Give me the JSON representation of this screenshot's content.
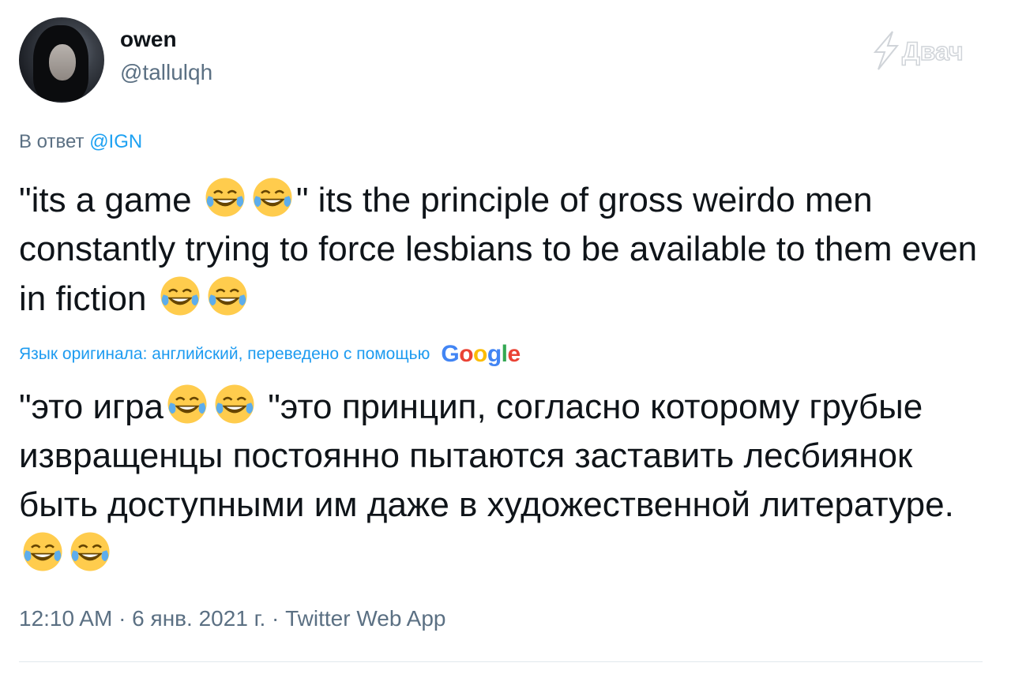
{
  "tweet": {
    "author_name": "owen",
    "author_handle": "@tallulqh",
    "reply_prefix": "В ответ ",
    "reply_mention": "@IGN",
    "original_part1": "\"its a game ",
    "original_part2": "\" its the principle of gross weirdo men constantly trying to force lesbians to be available to them even in fiction ",
    "translation_note": "Язык оригинала: английский, переведено с помощью",
    "translation_provider": "Google",
    "translated_part1": "\"это игра",
    "translated_part2": " \"это принцип, согласно которому грубые извращенцы постоянно пытаются заставить лесбиянок быть доступными им даже в художественной литературе.",
    "timestamp": "12:10 AM · 6 янв. 2021 г. · Twitter Web App"
  },
  "watermark": {
    "text": "Двач"
  },
  "icons": {
    "emoji": "face-with-tears-of-joy-icon"
  },
  "colors": {
    "link": "#1da1f2",
    "secondary_text": "#5b7083",
    "primary_text": "#0f1419"
  }
}
